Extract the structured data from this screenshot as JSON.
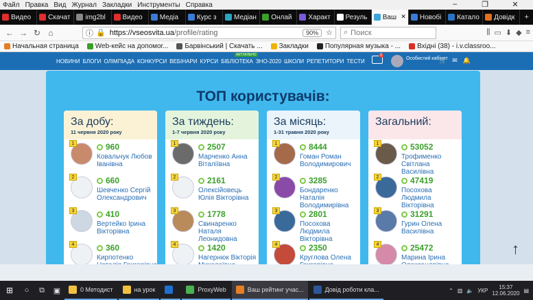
{
  "menu": [
    "Файл",
    "Правка",
    "Вид",
    "Журнал",
    "Закладки",
    "Инструменты",
    "Справка"
  ],
  "tabs": [
    {
      "label": "Видео",
      "color": "#e02d2d"
    },
    {
      "label": "Скачат",
      "color": "#e02d2d"
    },
    {
      "label": "img2bl",
      "color": "#888888"
    },
    {
      "label": "Видео",
      "color": "#e02d2d"
    },
    {
      "label": "Медіа",
      "color": "#3a7bd5"
    },
    {
      "label": "Курс з",
      "color": "#3a7bd5"
    },
    {
      "label": "Медіан",
      "color": "#2aa6c4"
    },
    {
      "label": "Онлай",
      "color": "#3aa02a"
    },
    {
      "label": "Характ",
      "color": "#7a5ad8"
    },
    {
      "label": "Резуль",
      "color": "#ffffff"
    },
    {
      "label": "Ваш",
      "color": "#3aa6d9",
      "active": true
    },
    {
      "label": "Новобі",
      "color": "#3a7bd5"
    },
    {
      "label": "Катало",
      "color": "#2a73c2"
    },
    {
      "label": "Довідк",
      "color": "#e07020"
    }
  ],
  "nav": {
    "url_host": "https://vseosvita.ua",
    "url_path": "/profile/rating",
    "zoom": "90%",
    "search_placeholder": "Поиск"
  },
  "bookmarks": [
    {
      "label": "Начальная страница",
      "color": "#e57e25"
    },
    {
      "label": "Web-кейс на допомог...",
      "color": "#3aa02a"
    },
    {
      "label": "Барвінський | Скачать ...",
      "color": "#555555"
    },
    {
      "label": "Закладки",
      "color": "#f0b400"
    },
    {
      "label": "Популярная музыка - ...",
      "color": "#222222"
    },
    {
      "label": "Вхідні (38) - i.v.classroo...",
      "color": "#d93025"
    }
  ],
  "site": {
    "nav": [
      "Новини",
      "Блоги",
      "Олімпіада",
      "Конкурси",
      "Вебінари",
      "Курси",
      "Бібліотека",
      "ЗНО-2020",
      "Школи",
      "Репетитори",
      "Тести"
    ],
    "new_badge": "АКТУАЛЬНО",
    "cabinet": "Особистий кабінет",
    "cart_count": "0",
    "title": "ТОП користувачів:"
  },
  "columns": [
    {
      "heading": "За добу:",
      "date": "11 червня 2020 року",
      "rows": [
        {
          "rank": "1",
          "points": "960",
          "name": "Ковальчук Любов Іванівна",
          "avatar": "#c98a6c"
        },
        {
          "rank": "2",
          "points": "660",
          "name": "Шевченко Сергій Олександрович",
          "avatar": "#eef2f5"
        },
        {
          "rank": "3",
          "points": "410",
          "name": "Вертейко Ірина Вікторівна",
          "avatar": "#cdd8e2"
        },
        {
          "rank": "4",
          "points": "360",
          "name": "Кирпотенко Наталія Григорівна",
          "avatar": "#eef2f5"
        }
      ]
    },
    {
      "heading": "За тиждень:",
      "date": "1-7 червня 2020 року",
      "rows": [
        {
          "rank": "1",
          "points": "2507",
          "name": "Марченко Анна Віталіївна",
          "avatar": "#6b6b6b"
        },
        {
          "rank": "2",
          "points": "2161",
          "name": "Олексійовець Юлія Вікторівна",
          "avatar": "#eef2f5"
        },
        {
          "rank": "3",
          "points": "1778",
          "name": "Свинаренко Наталя Леонидовна",
          "avatar": "#b98a5a"
        },
        {
          "rank": "4",
          "points": "1420",
          "name": "Нагернюк Вікторія Миколаївна",
          "avatar": "#eef2f5"
        }
      ]
    },
    {
      "heading": "За місяць:",
      "date": "1-31 травня 2020 року",
      "rows": [
        {
          "rank": "1",
          "points": "8444",
          "name": "Гоман Роман Володимирович",
          "avatar": "#a46a4a"
        },
        {
          "rank": "2",
          "points": "3285",
          "name": "Бондаренко Наталія Володимирівна",
          "avatar": "#8a4aa8"
        },
        {
          "rank": "3",
          "points": "2801",
          "name": "Посохова Людмила Вікторівна",
          "avatar": "#3a6a9a"
        },
        {
          "rank": "4",
          "points": "2350",
          "name": "Круглова Олена Григорівна",
          "avatar": "#c44a3a"
        }
      ]
    },
    {
      "heading": "Загальний:",
      "date": "",
      "rows": [
        {
          "rank": "1",
          "points": "53052",
          "name": "Трофименко Світлана Василівна",
          "avatar": "#6a5a4a"
        },
        {
          "rank": "2",
          "points": "47419",
          "name": "Посохова Людмила Вікторівна",
          "avatar": "#3a6a9a"
        },
        {
          "rank": "3",
          "points": "31291",
          "name": "Гурин Олена Василівна",
          "avatar": "#5a7aa8"
        },
        {
          "rank": "4",
          "points": "25472",
          "name": "Марина Ірина Олександрівна",
          "avatar": "#d48aa8"
        }
      ]
    }
  ],
  "taskbar": {
    "tasks": [
      {
        "label": "0 Методист",
        "color": "#f0c040"
      },
      {
        "label": "на урок",
        "color": "#f0c040"
      },
      {
        "label": "",
        "color": "#1f6fd0"
      },
      {
        "label": "ProxyWeb",
        "color": "#4caf50"
      },
      {
        "label": "Ваш рейтинг учас...",
        "color": "#e57e25",
        "active": true
      },
      {
        "label": "Довід роботи кла...",
        "color": "#2b5797"
      }
    ],
    "lang": "УКР",
    "time": "15:37",
    "date": "12.06.2020"
  }
}
